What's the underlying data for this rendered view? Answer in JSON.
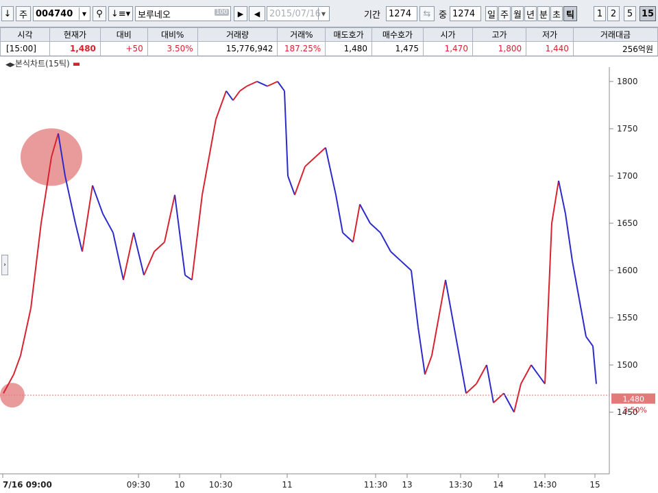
{
  "toolbar": {
    "down_arrow": "↓",
    "market": "주",
    "code": "004740",
    "name": "보루네오",
    "badge": "100",
    "date": "2015/07/16",
    "period_label": "기간",
    "period_value": "1274",
    "mid_label": "중",
    "mid_value": "1274",
    "periods": [
      "일",
      "주",
      "월",
      "년",
      "분",
      "초",
      "틱",
      "1",
      "2",
      "5",
      "15"
    ],
    "active_periods": [
      "틱",
      "15"
    ]
  },
  "quote": {
    "headers": [
      "시각",
      "현재가",
      "대비",
      "대비%",
      "거래량",
      "거래%",
      "매도호가",
      "매수호가",
      "시가",
      "고가",
      "저가",
      "거래대금"
    ],
    "values": [
      "[15:00]",
      "1,480",
      "+50",
      "3.50%",
      "15,776,942",
      "187.25%",
      "1,480",
      "1,475",
      "1,470",
      "1,800",
      "1,440",
      "256억원"
    ]
  },
  "chart": {
    "title": "본식차트(15틱)",
    "current_price_label": "1,480",
    "change_label": "3.50%",
    "colors": {
      "up": "#d8212f",
      "down": "#2a2acb",
      "highlight": "#e27a7a"
    }
  },
  "chart_data": {
    "type": "line",
    "y_ticks": [
      "1800",
      "1750",
      "1700",
      "1650",
      "1600",
      "1550",
      "1500",
      "1450"
    ],
    "x_ticks": [
      "7/16 09:00",
      "09:30",
      "10",
      "10:30",
      "11",
      "11:30",
      "13",
      "13:30",
      "14",
      "14:30",
      "15"
    ],
    "ylim": [
      1420,
      1810
    ],
    "series": [
      {
        "x": [
          0,
          15,
          25,
          40,
          55,
          70,
          80,
          90,
          105,
          115,
          130,
          145,
          160,
          175,
          190,
          205,
          220,
          235,
          250,
          265,
          275,
          290,
          300,
          310,
          325,
          335,
          345,
          355,
          370,
          385,
          400,
          410,
          415,
          425,
          440,
          455,
          470,
          485,
          495,
          510,
          520,
          535,
          550,
          565,
          580,
          595,
          605,
          615,
          625,
          635,
          645,
          660,
          675,
          690,
          705,
          715,
          730,
          745,
          755,
          770,
          780,
          790,
          800,
          810,
          820,
          830,
          840,
          850,
          860,
          865
        ],
        "y": [
          1470,
          1490,
          1510,
          1560,
          1650,
          1720,
          1745,
          1700,
          1650,
          1620,
          1690,
          1660,
          1640,
          1590,
          1640,
          1595,
          1620,
          1630,
          1680,
          1595,
          1590,
          1680,
          1720,
          1760,
          1790,
          1780,
          1790,
          1795,
          1800,
          1795,
          1800,
          1790,
          1700,
          1680,
          1710,
          1720,
          1730,
          1680,
          1640,
          1630,
          1670,
          1650,
          1640,
          1620,
          1610,
          1600,
          1540,
          1490,
          1510,
          1550,
          1590,
          1530,
          1470,
          1480,
          1500,
          1460,
          1470,
          1450,
          1480,
          1500,
          1490,
          1480,
          1650,
          1695,
          1660,
          1610,
          1570,
          1530,
          1520,
          1480
        ]
      }
    ]
  }
}
